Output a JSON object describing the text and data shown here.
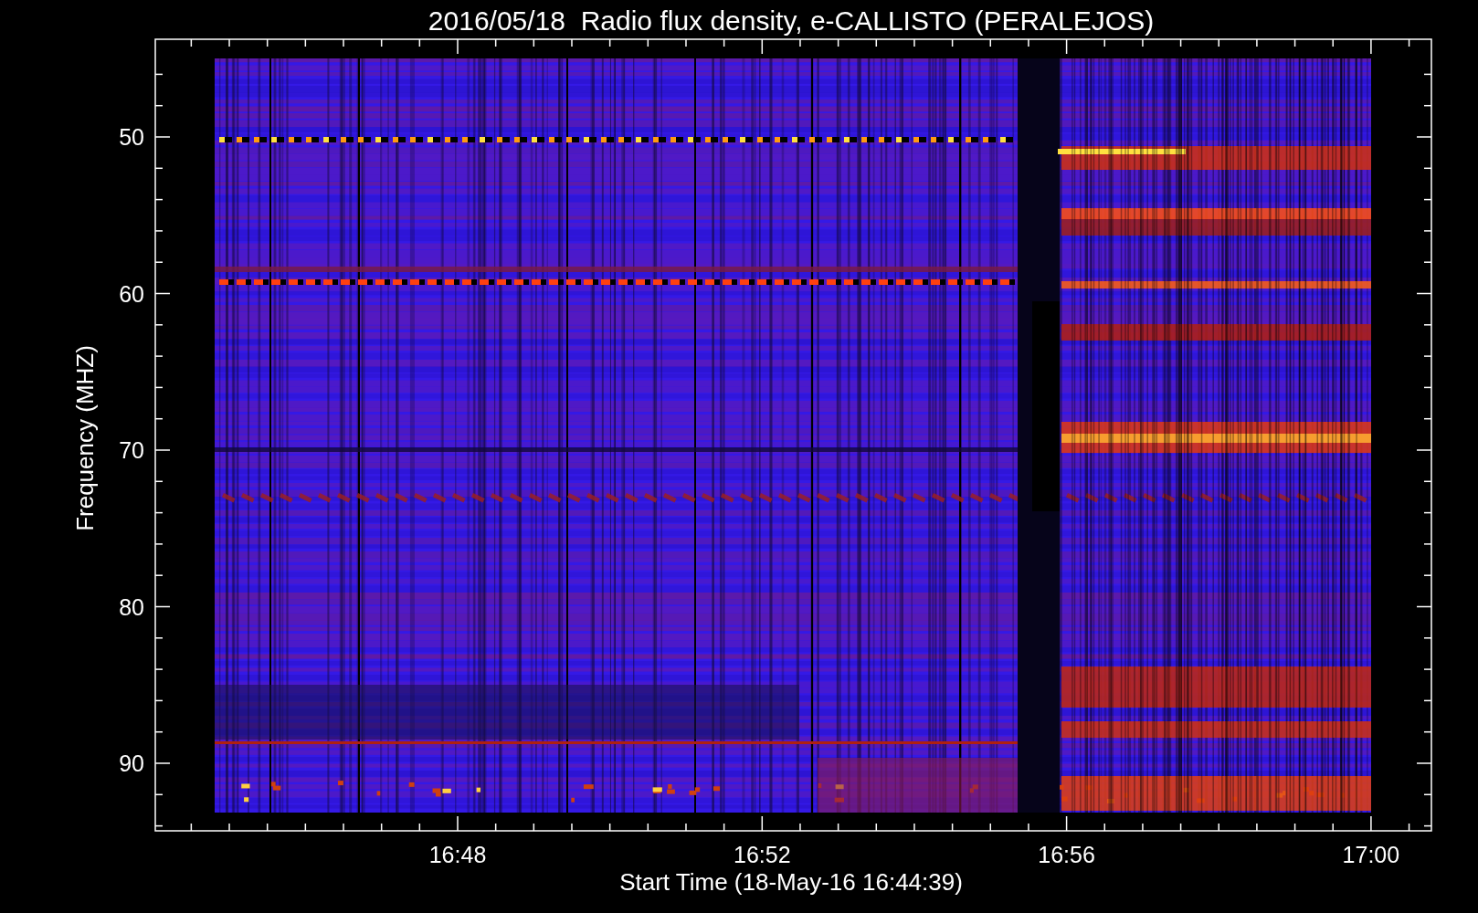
{
  "title": "2016/05/18  Radio flux density, e-CALLISTO (PERALEJOS)",
  "y_axis": {
    "label": "Frequency (MHZ)",
    "ticks": [
      "50",
      "60",
      "70",
      "80",
      "90"
    ]
  },
  "x_axis": {
    "label": "Start Time (18-May-16 16:44:39)",
    "ticks": [
      "16:48",
      "16:52",
      "16:56",
      "17:00"
    ]
  }
}
